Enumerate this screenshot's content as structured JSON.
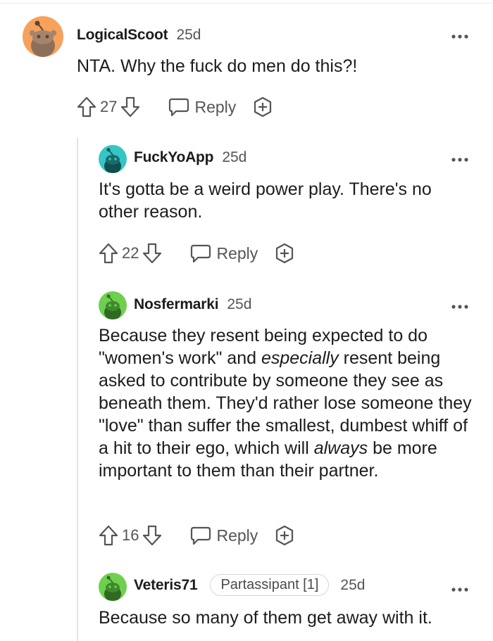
{
  "comments": [
    {
      "username": "LogicalScoot",
      "age": "25d",
      "text": "NTA. Why the fuck do men do this?!",
      "votes": "27",
      "reply_label": "Reply",
      "avatar_color": "#f6a15c"
    },
    {
      "username": "FuckYoApp",
      "age": "25d",
      "text": "It's gotta be a weird power play. There's no other reason.",
      "votes": "22",
      "reply_label": "Reply",
      "avatar_color": "#36c5c5"
    },
    {
      "username": "Nosfermarki",
      "age": "25d",
      "text_parts": [
        "Because they resent being expected to do \"women's work\" and ",
        "especially",
        " resent being asked to contribute by someone they see as beneath them. They'd rather lose someone they \"love\" than suffer the smallest, dumbest whiff of a hit to their ego, which will ",
        "always",
        " be more important to them than their partner."
      ],
      "votes": "16",
      "reply_label": "Reply",
      "avatar_color": "#6fcf4f"
    },
    {
      "username": "Veteris71",
      "flair": "Partassipant [1]",
      "age": "25d",
      "text": "Because so many of them get away with it.",
      "avatar_color": "#6fcf4f"
    }
  ],
  "icons": {
    "upvote": "upvote-arrow-icon",
    "downvote": "downvote-arrow-icon",
    "reply": "speech-bubble-icon",
    "award": "award-plus-icon",
    "more": "more-options-icon"
  }
}
